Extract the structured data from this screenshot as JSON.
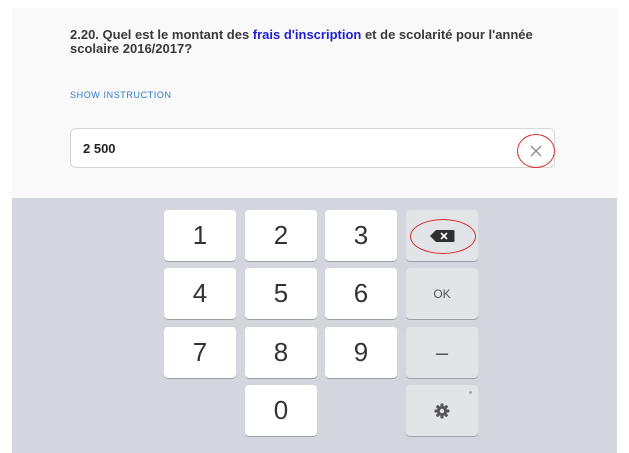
{
  "question": {
    "text_before": "2.20. Quel est le montant des ",
    "highlight": "frais d'inscription",
    "text_after": " et de scolarité pour l'année scolaire 2016/2017?",
    "show_instruction": "SHOW INSTRUCTION"
  },
  "answer": {
    "value": "2 500"
  },
  "keyboard": {
    "keys": [
      "1",
      "2",
      "3",
      "4",
      "5",
      "6",
      "7",
      "8",
      "9",
      "0"
    ],
    "ok_label": "OK",
    "dash_label": "–"
  },
  "colors": {
    "highlight": "#1f1fcf",
    "annotation_circle": "#d32f2f",
    "keyboard_bg": "#d3d6dd"
  },
  "icons": {
    "clear": "close-icon",
    "backspace": "backspace-icon",
    "settings": "gear-icon"
  }
}
